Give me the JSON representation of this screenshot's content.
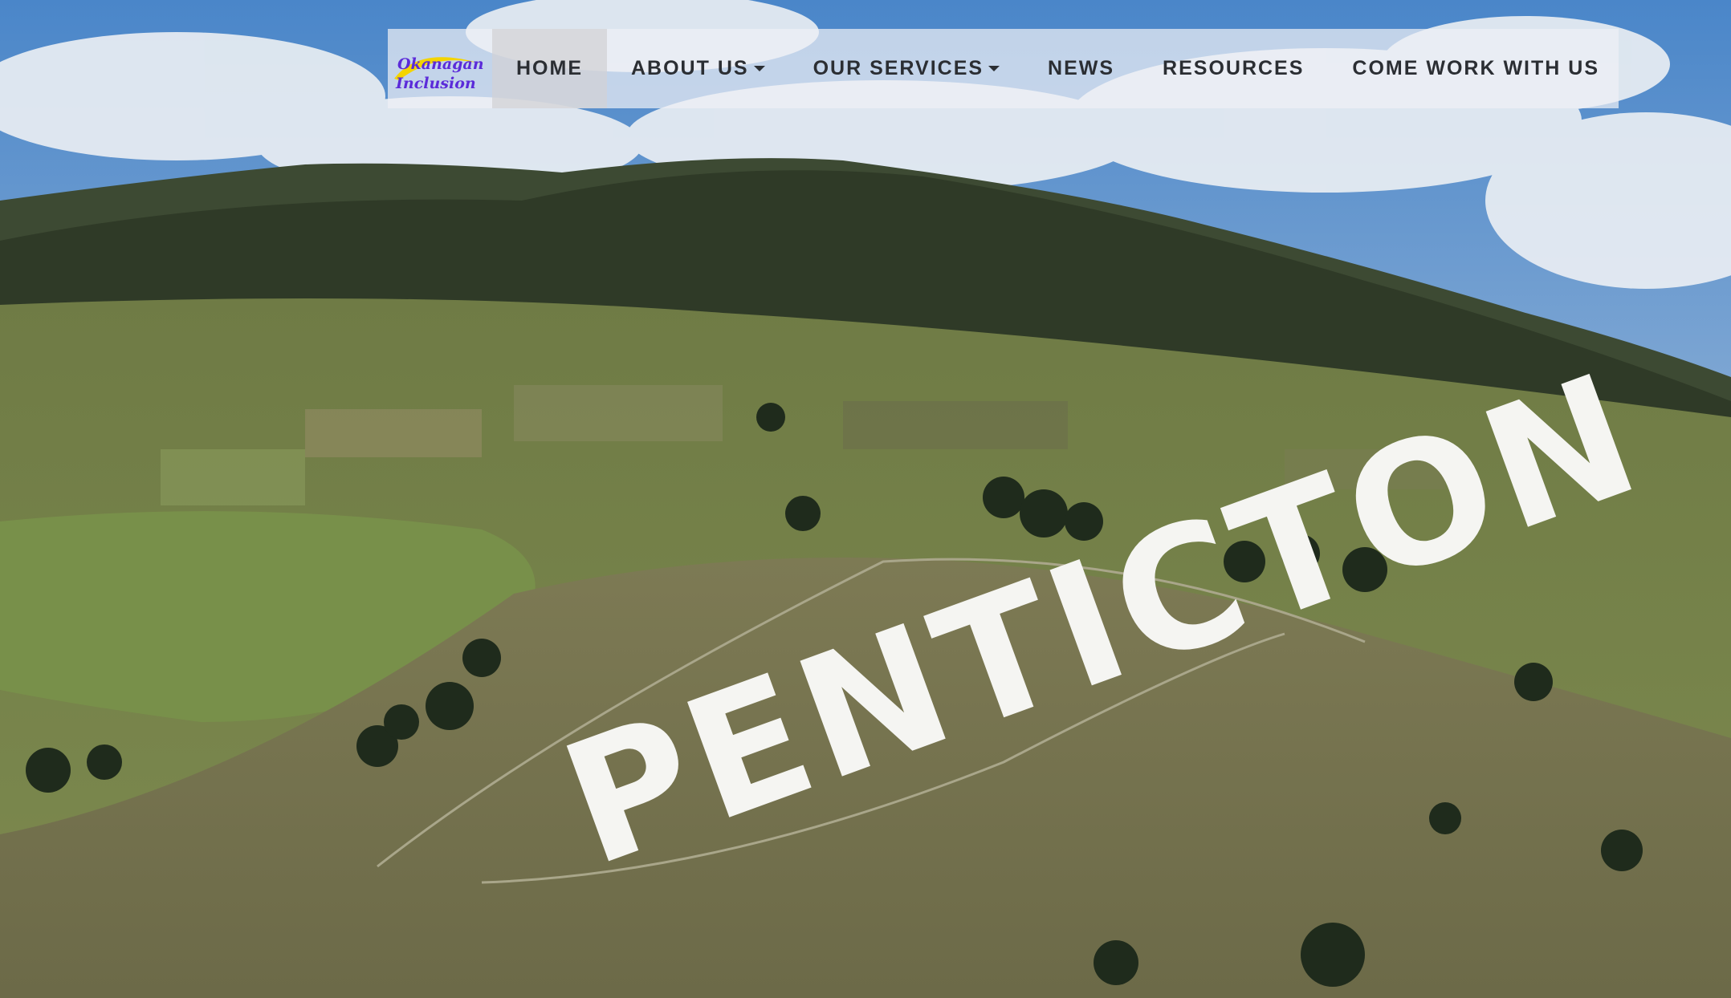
{
  "brand": {
    "line1": "Okanagan",
    "line2": "Inclusion",
    "colors": {
      "text": "#5b2bd9",
      "swoosh": "#f4d400"
    }
  },
  "nav": {
    "items": [
      {
        "label": "HOME",
        "active": true
      },
      {
        "label": "ABOUT US",
        "dropdown": true
      },
      {
        "label": "OUR SERVICES",
        "dropdown": true
      },
      {
        "label": "NEWS"
      },
      {
        "label": "RESOURCES"
      },
      {
        "label": "COME WORK WITH US"
      }
    ]
  },
  "hero": {
    "sign_text": "PENTICTON"
  }
}
